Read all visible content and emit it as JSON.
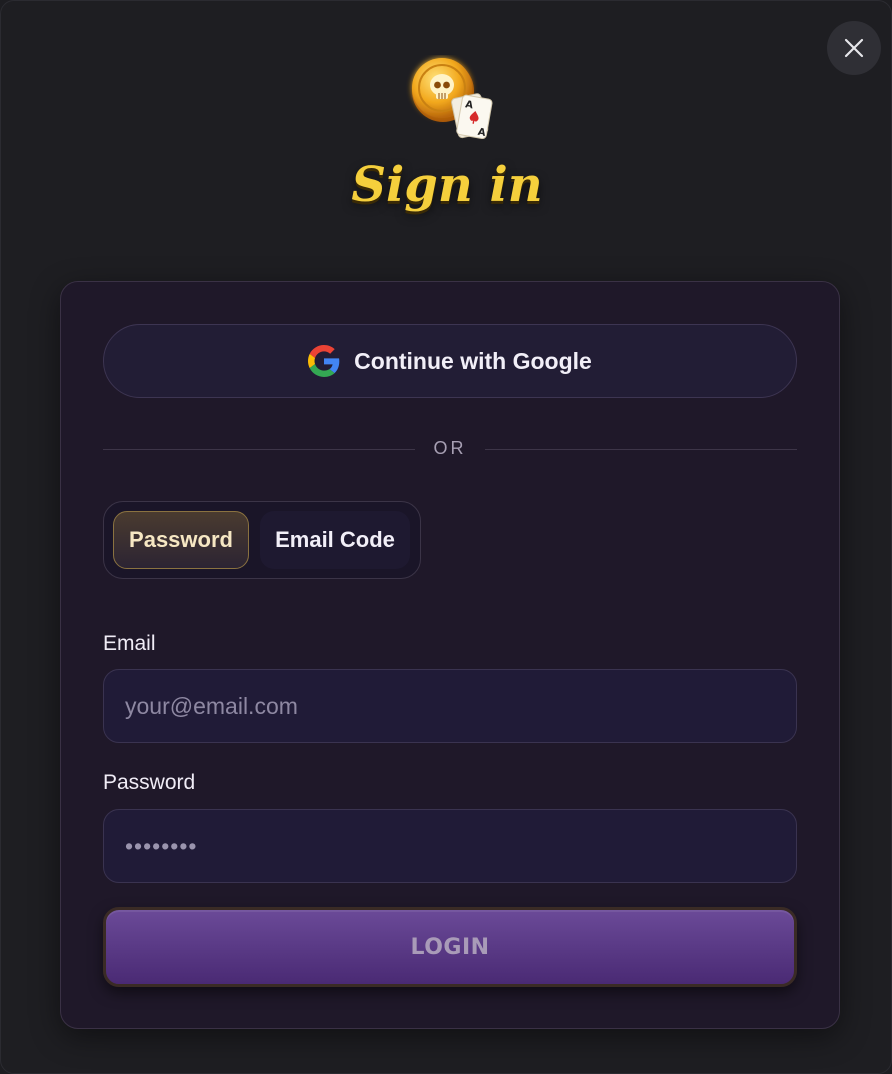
{
  "dialog": {
    "title": "Sign in",
    "close_icon": "close-icon",
    "logo_icon": "skull-coin-cards-logo"
  },
  "google": {
    "label": "Continue with Google",
    "icon": "google-icon"
  },
  "divider": {
    "text": "OR"
  },
  "tabs": [
    {
      "label": "Password",
      "active": true
    },
    {
      "label": "Email Code",
      "active": false
    }
  ],
  "fields": {
    "email": {
      "label": "Email",
      "placeholder": "your@email.com",
      "value": ""
    },
    "password": {
      "label": "Password",
      "value": "••••••••"
    }
  },
  "login": {
    "label": "LOGIN"
  },
  "colors": {
    "accent_gold": "#f5cf3c",
    "button_purple": "#5a3a86",
    "card_bg": "#1f1829"
  }
}
